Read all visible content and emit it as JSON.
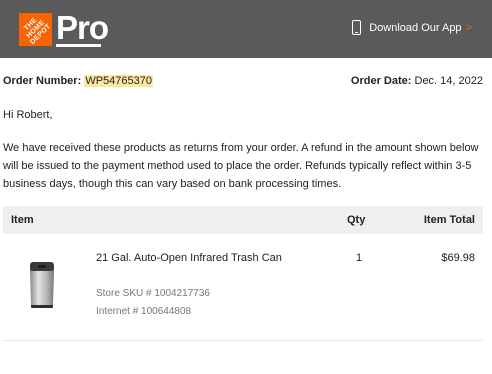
{
  "header": {
    "logo_text": "THE\nHOME\nDEPOT",
    "pro_label": "Pro",
    "app_link_label": "Download Our App",
    "app_link_chevron": ">",
    "phone_icon": "phone-icon",
    "brand_color": "#f96302",
    "bg_color": "#5a5a5a"
  },
  "order": {
    "number_label": "Order Number:",
    "number_value": "WP54765370",
    "date_label": "Order Date:",
    "date_value": "Dec. 14, 2022"
  },
  "greeting": "Hi Robert,",
  "message": "We have received these products as returns from your order. A refund in the amount shown below will be issued to the payment method used to place the order. Refunds typically reflect within 3-5 business days, though this can vary based on bank processing times.",
  "table": {
    "headers": {
      "item": "Item",
      "qty": "Qty",
      "total": "Item Total"
    },
    "rows": [
      {
        "name": "21 Gal. Auto-Open Infrared Trash Can",
        "qty": "1",
        "total": "$69.98",
        "sku": "Store SKU # 1004217736",
        "internet": "Internet # 100644808",
        "image": "trash-can-image"
      }
    ]
  }
}
